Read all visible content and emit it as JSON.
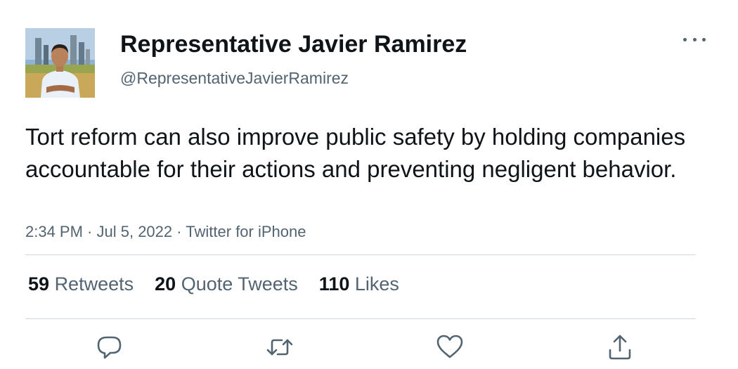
{
  "author": {
    "display_name": "Representative Javier Ramirez",
    "handle": "@RepresentativeJavierRamirez"
  },
  "tweet": {
    "text": "Tort reform can also improve public safety by holding companies accountable for their actions and preventing negligent behavior.",
    "time": "2:34 PM",
    "date": "Jul 5, 2022",
    "source": "Twitter for iPhone",
    "separator": " · "
  },
  "stats": {
    "retweets": {
      "count": "59",
      "label": "Retweets"
    },
    "quote_tweets": {
      "count": "20",
      "label": "Quote Tweets"
    },
    "likes": {
      "count": "110",
      "label": "Likes"
    }
  },
  "icons": {
    "more": "more-horizontal-icon",
    "reply": "reply-icon",
    "retweet": "retweet-icon",
    "like": "heart-icon",
    "share": "share-icon"
  },
  "colors": {
    "text": "#0f1419",
    "secondary": "#536471",
    "divider": "#cfd9de"
  }
}
